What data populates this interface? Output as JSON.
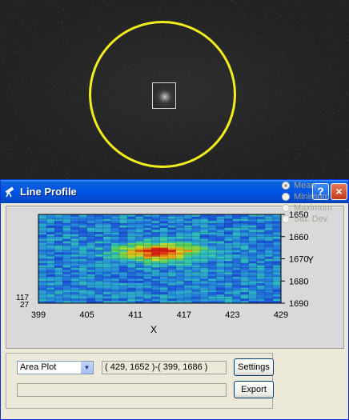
{
  "image": {
    "description_icon": "star-field"
  },
  "window": {
    "title": "Line Profile",
    "help_label": "?",
    "close_label": "×"
  },
  "plot": {
    "x_label": "X",
    "y_label": "Y",
    "x_ticks": [
      "399",
      "405",
      "411",
      "417",
      "423",
      "429"
    ],
    "y_ticks": [
      "1650",
      "1660",
      "1670",
      "1680",
      "1690"
    ],
    "z_ticks": [
      "117",
      "27"
    ]
  },
  "controls": {
    "mode_value": "Area Plot",
    "coords_text": "( 429, 1652 )-( 399, 1686 )",
    "status_text": "",
    "settings_label": "Settings",
    "export_label": "Export"
  },
  "stats": {
    "options": [
      "Mean",
      "Minimum",
      "Maximum",
      "Std. Dev."
    ],
    "selected": "Mean"
  },
  "chart_data": {
    "type": "heatmap",
    "xlabel": "X",
    "ylabel": "Y",
    "xlim": [
      399,
      429
    ],
    "ylim": [
      1650,
      1690
    ],
    "zlim": [
      27,
      117
    ],
    "x_ticks": [
      399,
      405,
      411,
      417,
      423,
      429
    ],
    "y_ticks": [
      1650,
      1660,
      1670,
      1680,
      1690
    ],
    "peak": {
      "x": 414,
      "y": 1667
    }
  }
}
